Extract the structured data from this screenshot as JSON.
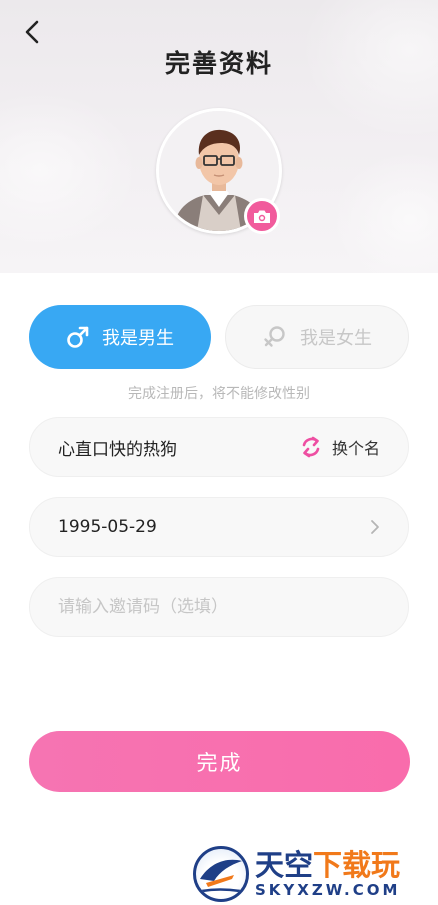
{
  "header": {
    "title": "完善资料"
  },
  "gender": {
    "male_label": "我是男生",
    "female_label": "我是女生",
    "note": "完成注册后，将不能修改性别",
    "selected": "male"
  },
  "form": {
    "nickname": "心直口快的热狗",
    "rename_label": "换个名",
    "birthday": "1995-05-29",
    "invite_value": "",
    "invite_placeholder": "请输入邀请码（选填）"
  },
  "submit_label": "完成",
  "watermark": {
    "cn_part1": "天空",
    "cn_part2": "下载玩",
    "en": "SKYXZW.COM"
  },
  "colors": {
    "male_active": "#38a8f3",
    "accent_pink": "#f15b9c",
    "submit": "#f96cac",
    "watermark_blue": "#1f3f87",
    "watermark_orange": "#f1791a"
  },
  "icons": [
    "back-arrow-icon",
    "camera-icon",
    "male-symbol-icon",
    "female-symbol-icon",
    "refresh-icon",
    "chevron-right-icon",
    "skyxzw-logo-icon"
  ]
}
